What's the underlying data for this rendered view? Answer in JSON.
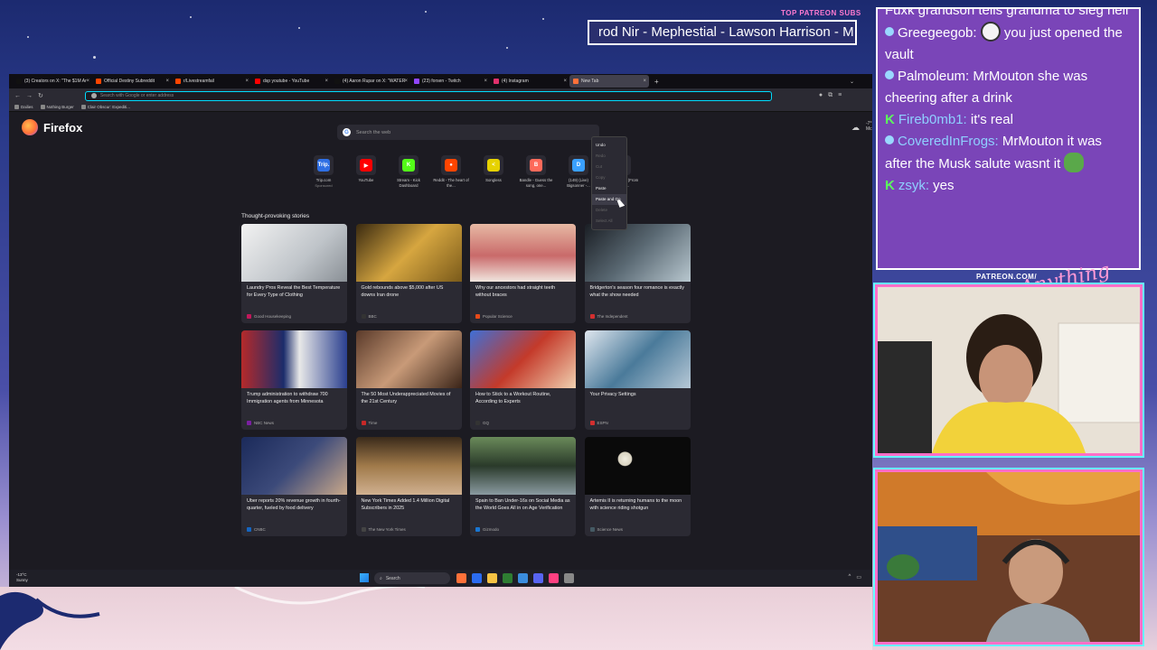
{
  "overlay": {
    "ticker_label": "TOP PATREON SUBS",
    "ticker_text": "rod Nir - Mephestial - Lawson Harrison - M",
    "patreon_url": "PATREON.COM/",
    "signature": "Anything Else?"
  },
  "browser": {
    "tabs": [
      {
        "label": "(3) Creators on X: \"The $1M Ar",
        "color": "#111111"
      },
      {
        "label": "Official Destiny Subreddit",
        "color": "#ff4500"
      },
      {
        "label": "r/Livestreamfail",
        "color": "#ff4500"
      },
      {
        "label": "dsp youtube - YouTube",
        "color": "#ff0000"
      },
      {
        "label": "(4) Aaron Rupar on X: \"WATER",
        "color": "#111111"
      },
      {
        "label": "(23) forsen - Twitch",
        "color": "#9146ff"
      },
      {
        "label": "(4) Instagram",
        "color": "#e1306c"
      },
      {
        "label": "New Tab",
        "color": "#ff7139"
      }
    ],
    "tab_close": "×",
    "new_tab": "+",
    "tab_overflow": "⌄",
    "url_placeholder": "Search with Google or enter address",
    "bookmarks": [
      "Dailies",
      "Nothing Burger",
      "Clair Obscur: Expediti..."
    ],
    "brand": "Firefox",
    "search_placeholder": "Search the web",
    "weather": "-7°",
    "weather_sub": "Mc",
    "shortcuts": [
      {
        "label": "Trip.com",
        "sub": "Sponsored",
        "icon": "Trip.",
        "color": "#2f6fe4"
      },
      {
        "label": "YouTube",
        "sub": "",
        "icon": "▶",
        "color": "#ff0000"
      },
      {
        "label": "Stream - Kick Dashboard",
        "sub": "",
        "icon": "K",
        "color": "#53fc18"
      },
      {
        "label": "Reddit - The heart of the...",
        "sub": "",
        "icon": "●",
        "color": "#ff4500"
      },
      {
        "label": "Songless",
        "sub": "",
        "icon": "<",
        "color": "#e6d200"
      },
      {
        "label": "Bandle - Guess the song, one...",
        "sub": "",
        "icon": "B",
        "color": "#ff6a5a"
      },
      {
        "label": "(149) (Live) Bigsonner -...",
        "sub": "",
        "icon": "D",
        "color": "#3aa0ff"
      },
      {
        "label": "I'm A Believer (From \"Shrek\"...",
        "sub": "",
        "icon": "♪",
        "color": "#555555"
      }
    ],
    "stories_title": "Thought-provoking stories",
    "stories": [
      {
        "title": "Laundry Pros Reveal the Best Temperature for Every Type of Clothing",
        "source": "Good Housekeeping",
        "color": "#c2185b",
        "img": "linear-gradient(135deg,#f2f2f2,#bfc4c9 60%,#8a9096)"
      },
      {
        "title": "Gold rebounds above $5,000 after US downs Iran drone",
        "source": "BBC",
        "color": "#333333",
        "img": "linear-gradient(135deg,#3a2a10,#d6a640 50%,#7a5a1a)"
      },
      {
        "title": "Why our ancestors had straight teeth without braces",
        "source": "Popular Science",
        "color": "#e64a19",
        "img": "linear-gradient(180deg,#e7b9a4,#c96a6a 55%,#f1e6df)"
      },
      {
        "title": "Bridgerton's season four romance is exactly what the show needed",
        "source": "The Independent",
        "color": "#d32f2f",
        "img": "linear-gradient(135deg,#1a1e24,#5b6a74 50%,#b8c7cf)"
      },
      {
        "title": "Trump administration to withdraw 700 Immigration agents from Minnesota",
        "source": "NBC News",
        "color": "#7b1fa2",
        "img": "linear-gradient(90deg,#b52a2a,#1b2c6b 40%,#e8e8e8 55%,#2a3f8f)"
      },
      {
        "title": "The 50 Most Underappreciated Movies of the 21st Century",
        "source": "Time",
        "color": "#c62828",
        "img": "linear-gradient(135deg,#5a3a2a,#c89a78 50%,#3a2418)"
      },
      {
        "title": "How to Stick to a Workout Routine, According to Experts",
        "source": "GQ",
        "color": "#333333",
        "img": "linear-gradient(135deg,#3f6fd6,#c43a2a 50%,#f0d0b0)"
      },
      {
        "title": "Your Privacy Settings",
        "source": "ESPN",
        "color": "#d32f2f",
        "img": "linear-gradient(135deg,#dfe6ee,#4a7a9a 50%,#b6c8d6)"
      },
      {
        "title": "Uber reports 20% revenue growth in fourth-quarter, fueled by food delivery",
        "source": "CNBC",
        "color": "#1565c0",
        "img": "linear-gradient(135deg,#1b2a5a,#3c4a7a 50%,#c9a88a)"
      },
      {
        "title": "New York Times Added 1.4 Million Digital Subscribers in 2025",
        "source": "The New York Times",
        "color": "#444444",
        "img": "linear-gradient(180deg,#3a2a1a,#a07a4a 50%,#d0b090)"
      },
      {
        "title": "Spain to Ban Under-16s on Social Media as the World Goes All in on Age Verification",
        "source": "Gizmodo",
        "color": "#1976d2",
        "img": "linear-gradient(180deg,#6a8a5a,#2a3a2a 50%,#8a9aa0)"
      },
      {
        "title": "Artemis II is returning humans to the moon with science riding shotgun",
        "source": "Science News",
        "color": "#455a64",
        "img": "radial-gradient(circle at 38% 38%,#f0ede0 0,#d8d2c0 9%,#0a0a0a 10%)"
      }
    ],
    "context_menu": [
      {
        "label": "Undo",
        "state": "on"
      },
      {
        "label": "Redo",
        "state": "off"
      },
      {
        "label": "Cut",
        "state": "off"
      },
      {
        "label": "Copy",
        "state": "off"
      },
      {
        "label": "Paste",
        "state": "on"
      },
      {
        "label": "Paste and Go",
        "state": "hl"
      },
      {
        "label": "Delete",
        "state": "off"
      },
      {
        "label": "Select All",
        "state": "off"
      }
    ]
  },
  "taskbar": {
    "weather_temp": "-13°C",
    "weather_desc": "Sunny",
    "search_label": "Search",
    "apps": [
      "#ff7139",
      "#2b6cf0",
      "#f6c343",
      "#2e7d32",
      "#3a8dde",
      "#5865f2",
      "#ff4081",
      "#888888"
    ]
  },
  "chat": {
    "lines": [
      {
        "user": "",
        "text": "Fuxk grandson tells grandma to sieg heil",
        "badge": "none",
        "user_color": "#ffffff"
      },
      {
        "user": "Greegeegob:",
        "text": " you just opened the vault",
        "badge": "circle",
        "user_color": "#ffffff",
        "emote": true
      },
      {
        "user": "Palmoleum:",
        "text": " MrMouton she was cheering after a drink",
        "badge": "circle",
        "user_color": "#ffffff"
      },
      {
        "user": "Fireb0mb1:",
        "text": " it's real",
        "badge": "k",
        "user_color": "#8fd0ff"
      },
      {
        "user": "CoveredInFrogs:",
        "text": " MrMouton it was after the Musk salute wasnt it",
        "badge": "circle",
        "user_color": "#8fd0ff",
        "frog": true
      },
      {
        "user": "zsyk:",
        "text": " yes",
        "badge": "k",
        "user_color": "#8fd0ff"
      }
    ]
  }
}
